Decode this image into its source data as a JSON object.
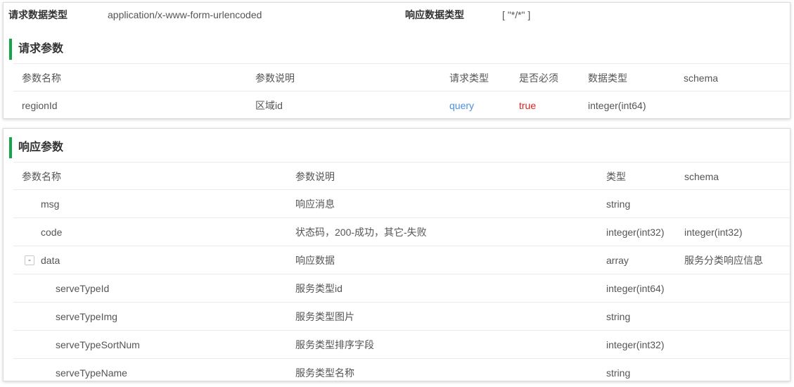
{
  "content_types": {
    "request_label": "请求数据类型",
    "request_value": "application/x-www-form-urlencoded",
    "response_label": "响应数据类型",
    "response_value": "[ \"*/*\" ]"
  },
  "request_params": {
    "title": "请求参数",
    "headers": [
      "参数名称",
      "参数说明",
      "请求类型",
      "是否必须",
      "数据类型",
      "schema"
    ],
    "rows": [
      {
        "name": "regionId",
        "desc": "区域id",
        "in": "query",
        "required": "true",
        "type": "integer(int64)",
        "schema": ""
      }
    ]
  },
  "response_params": {
    "title": "响应参数",
    "headers": [
      "参数名称",
      "参数说明",
      "类型",
      "schema"
    ],
    "collapse_symbol": "-",
    "rows": [
      {
        "name": "msg",
        "desc": "响应消息",
        "type": "string",
        "schema": ""
      },
      {
        "name": "code",
        "desc": "状态码，200-成功，其它-失败",
        "type": "integer(int32)",
        "schema": "integer(int32)"
      },
      {
        "name": "data",
        "desc": "响应数据",
        "type": "array",
        "schema": "服务分类响应信息"
      },
      {
        "name": "serveTypeId",
        "desc": "服务类型id",
        "type": "integer(int64)",
        "schema": ""
      },
      {
        "name": "serveTypeImg",
        "desc": "服务类型图片",
        "type": "string",
        "schema": ""
      },
      {
        "name": "serveTypeSortNum",
        "desc": "服务类型排序字段",
        "type": "integer(int32)",
        "schema": ""
      },
      {
        "name": "serveTypeName",
        "desc": "服务类型名称",
        "type": "string",
        "schema": ""
      }
    ]
  },
  "colors": {
    "accent_green": "#16a34a",
    "query_blue": "#4a90e2",
    "required_red": "#e02020"
  }
}
